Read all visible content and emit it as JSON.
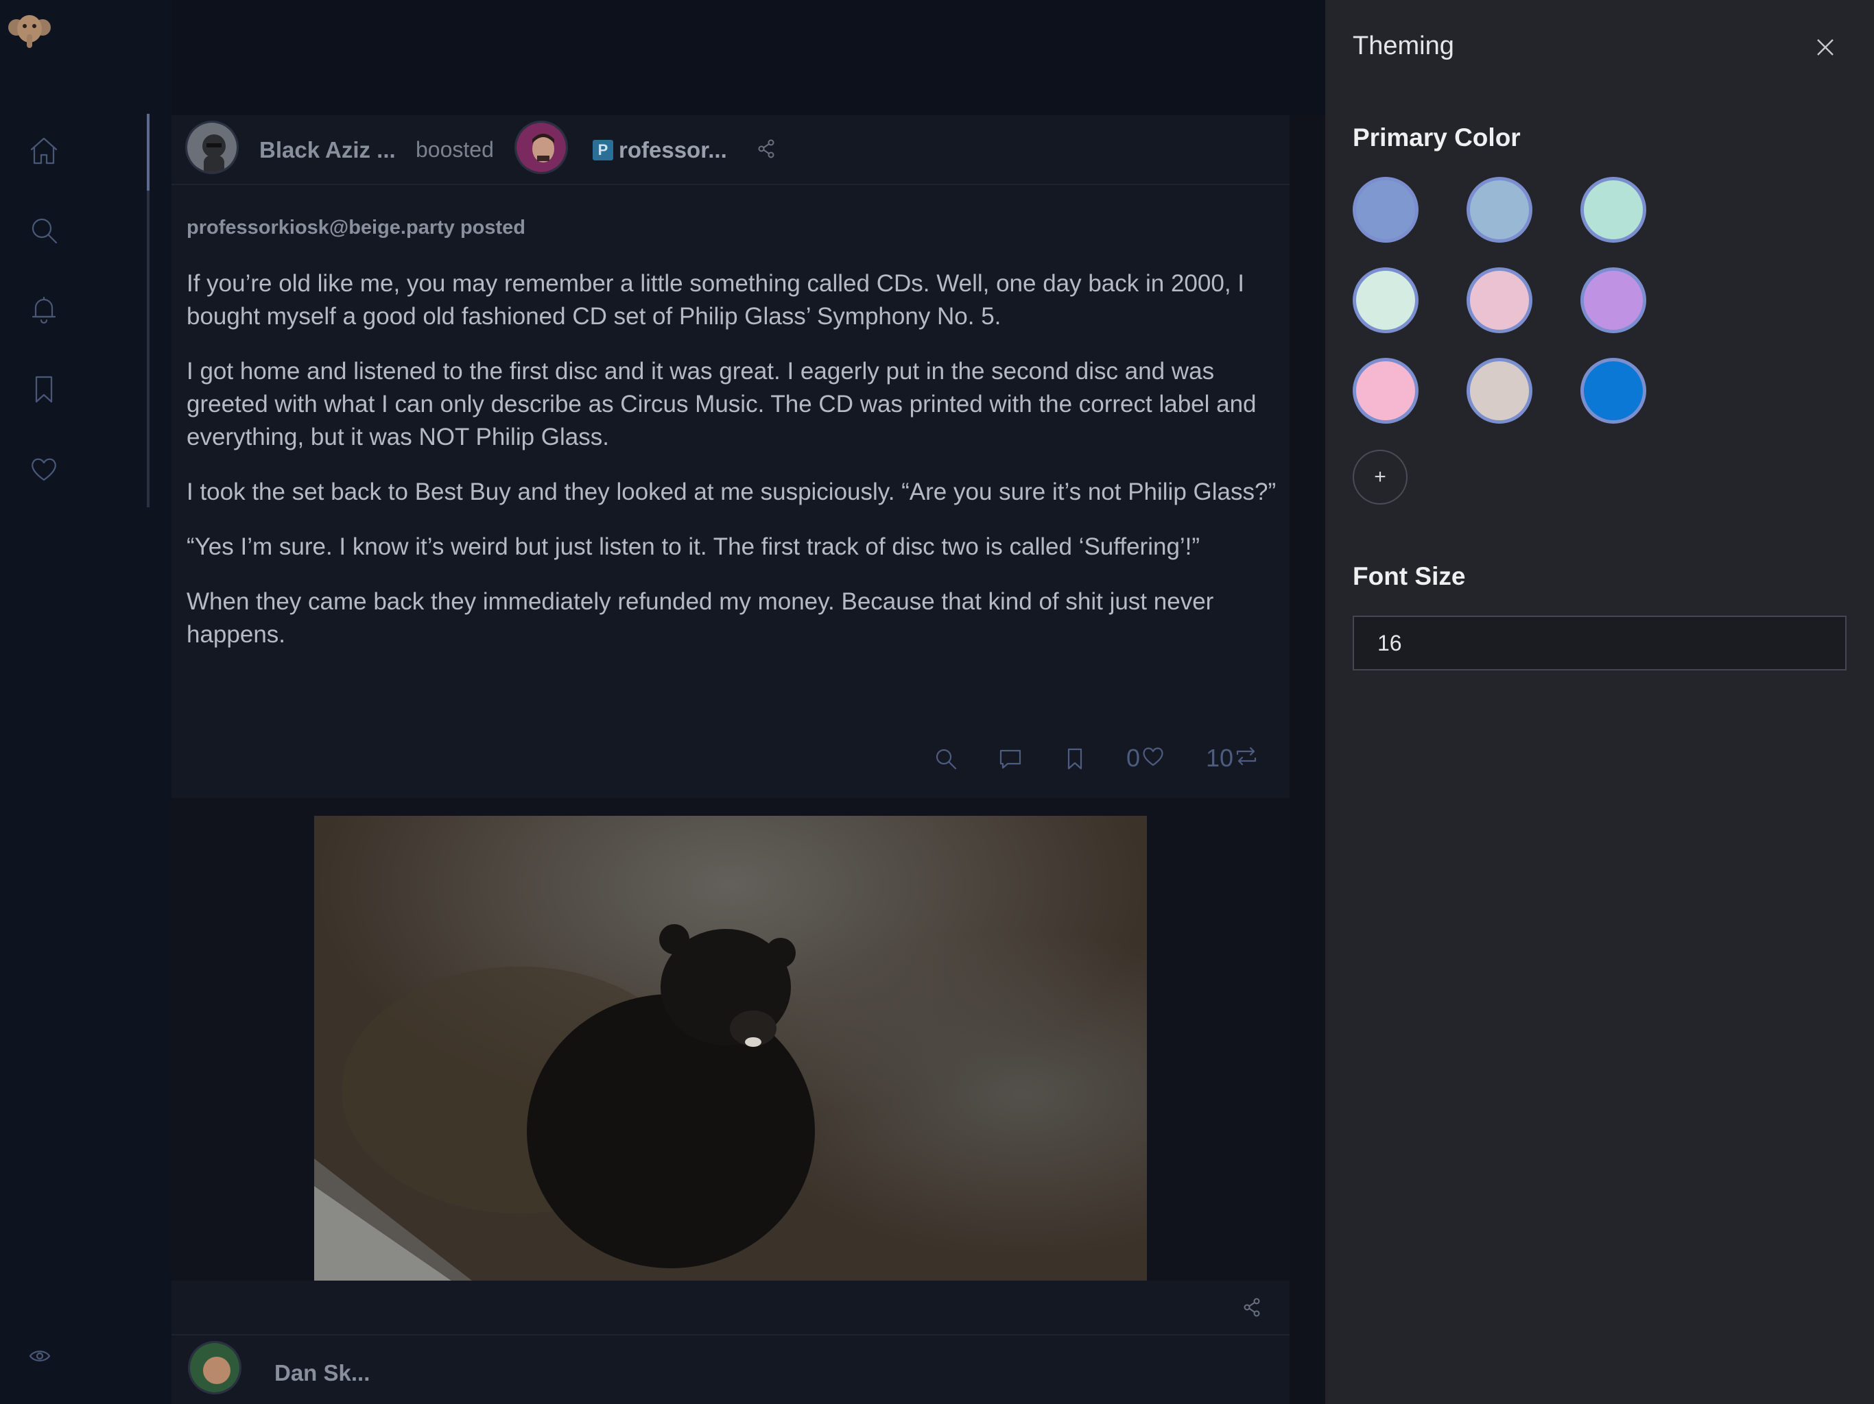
{
  "app": {
    "logo": "mastodon-elephant-icon"
  },
  "nav": [
    {
      "name": "home",
      "icon": "home-icon"
    },
    {
      "name": "search",
      "icon": "search-icon"
    },
    {
      "name": "notifications",
      "icon": "bell-icon"
    },
    {
      "name": "bookmarks",
      "icon": "bookmark-icon"
    },
    {
      "name": "favourites",
      "icon": "heart-icon"
    }
  ],
  "post": {
    "booster_name": "Black Aziz ...",
    "boosted_label": "boosted",
    "author_badge": "P",
    "author_name": "rofessor...",
    "posted_by": "professorkiosk@beige.party posted",
    "paragraphs": [
      "If you’re old like me, you may remember a little something called CDs. Well, one day back in 2000, I bought myself a good old fashioned CD set of Philip Glass’ Symphony No. 5.",
      "I got home and listened to the first disc and it was great. I eagerly put in the second disc and was greeted with what I can only describe as Circus Music. The CD was printed with the correct label and everything, but it was NOT Philip Glass.",
      "I took the set back to Best Buy and they looked at me suspiciously. “Are you sure it’s not Philip Glass?”",
      "“Yes I’m sure. I know it’s weird but just listen to it. The first track of disc two is called ‘Suffering’!”",
      "When they came back they immediately refunded my money. Because that kind of shit just never happens."
    ],
    "like_count": "0",
    "boost_count": "10"
  },
  "next_post": {
    "name_partial": "Dan Sk..."
  },
  "theming": {
    "title": "Theming",
    "primary_color_heading": "Primary Color",
    "swatches": [
      "#8098d0",
      "#98b8d4",
      "#b4e2d6",
      "#d4ece2",
      "#eac2d2",
      "#c092e4",
      "#f6b8d0",
      "#d8ccc8",
      "#0a78d4"
    ],
    "add_label": "+",
    "font_size_heading": "Font Size",
    "font_size_value": "16"
  },
  "colors": {
    "accent": "#7b8fd0",
    "panel_bg": "#23252b",
    "page_bg": "#0f121b"
  }
}
